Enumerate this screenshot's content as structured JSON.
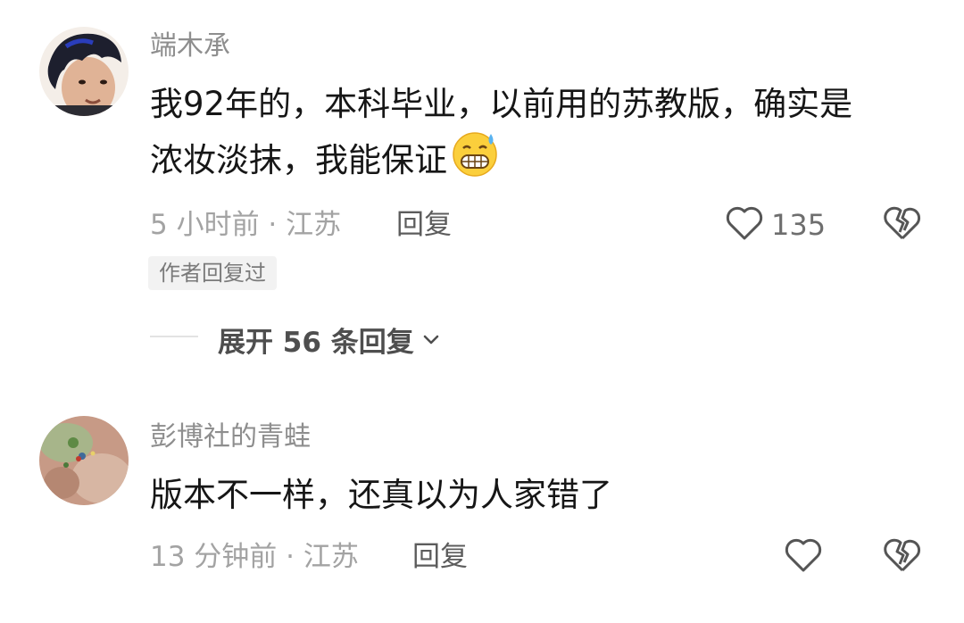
{
  "comments": [
    {
      "username": "端木承",
      "text": "我92年的，本科毕业，以前用的苏教版，确实是浓妆淡抹，我能保证",
      "text_line1": "我92年的，本科毕业，以前用的苏教版，确实是",
      "text_line2": "浓妆淡抹，我能保证",
      "emoji": "grimacing-sweat-emoji",
      "time": "5 小时前 · 江苏",
      "reply_label": "回复",
      "like_count": "135",
      "badge": "作者回复过",
      "expand_label": "展开 56 条回复"
    },
    {
      "username": "彭博社的青蛙",
      "text": "版本不一样，还真以为人家错了",
      "time": "13 分钟前 · 江苏",
      "reply_label": "回复",
      "like_count": ""
    }
  ],
  "icons": {
    "like": "heart-outline-icon",
    "dislike": "broken-heart-icon",
    "expand": "chevron-down-icon"
  },
  "colors": {
    "background": "#ffffff",
    "username": "#8e8e8e",
    "text": "#161616",
    "meta": "#a3a3a3",
    "icon": "#555555"
  }
}
